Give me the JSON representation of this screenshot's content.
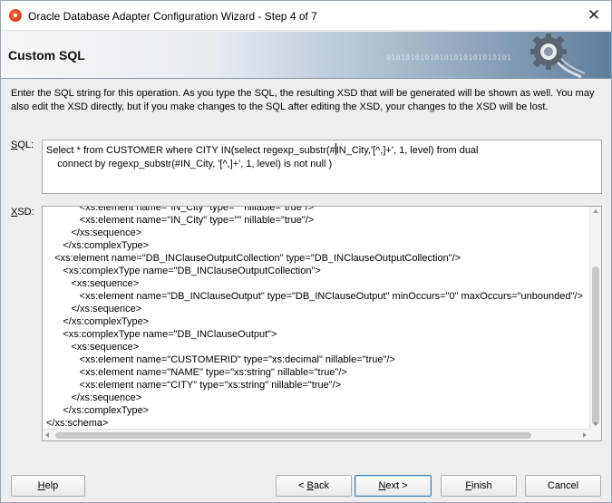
{
  "window": {
    "title": "Oracle Database Adapter Configuration Wizard - Step 4 of 7",
    "close_glyph": "✕"
  },
  "banner": {
    "title": "Custom SQL",
    "binary_text": "01010101010101010101010101",
    "icon": "gear-icon"
  },
  "instructions": "Enter the SQL string for this operation.  As you type the SQL, the resulting XSD that will be generated will be shown as well.  You may also edit the XSD directly, but if you make changes to the SQL after editing the XSD, your changes to the XSD will be lost.",
  "sql": {
    "label_mnemonic": "S",
    "label_rest": "QL:",
    "line1_before_caret": "Select * from CUSTOMER where CITY IN(select regexp_substr(#",
    "line1_after_caret": "IN_City,'[^,]+', 1, level) from dual",
    "line2": "    connect by regexp_substr(#IN_City, '[^,]+', 1, level) is not null )"
  },
  "xsd": {
    "label_mnemonic": "X",
    "label_rest": "SD:",
    "lines": [
      "            <xs:element name=\"IN_City\" type=\"\" nillable=\"true\"/>",
      "            <xs:element name=\"IN_City\" type=\"\" nillable=\"true\"/>",
      "         </xs:sequence>",
      "      </xs:complexType>",
      "   <xs:element name=\"DB_INClauseOutputCollection\" type=\"DB_INClauseOutputCollection\"/>",
      "      <xs:complexType name=\"DB_INClauseOutputCollection\">",
      "         <xs:sequence>",
      "            <xs:element name=\"DB_INClauseOutput\" type=\"DB_INClauseOutput\" minOccurs=\"0\" maxOccurs=\"unbounded\"/>",
      "         </xs:sequence>",
      "      </xs:complexType>",
      "      <xs:complexType name=\"DB_INClauseOutput\">",
      "         <xs:sequence>",
      "            <xs:element name=\"CUSTOMERID\" type=\"xs:decimal\" nillable=\"true\"/>",
      "            <xs:element name=\"NAME\" type=\"xs:string\" nillable=\"true\"/>",
      "            <xs:element name=\"CITY\" type=\"xs:string\" nillable=\"true\"/>",
      "         </xs:sequence>",
      "      </xs:complexType>",
      "</xs:schema>"
    ]
  },
  "buttons": {
    "help": {
      "mnemonic": "H",
      "rest": "elp"
    },
    "back": {
      "prefix": "< ",
      "mnemonic": "B",
      "rest": "ack"
    },
    "next": {
      "mnemonic": "N",
      "rest": "ext >"
    },
    "finish": {
      "mnemonic": "F",
      "rest": "inish"
    },
    "cancel": {
      "label": "Cancel"
    }
  }
}
